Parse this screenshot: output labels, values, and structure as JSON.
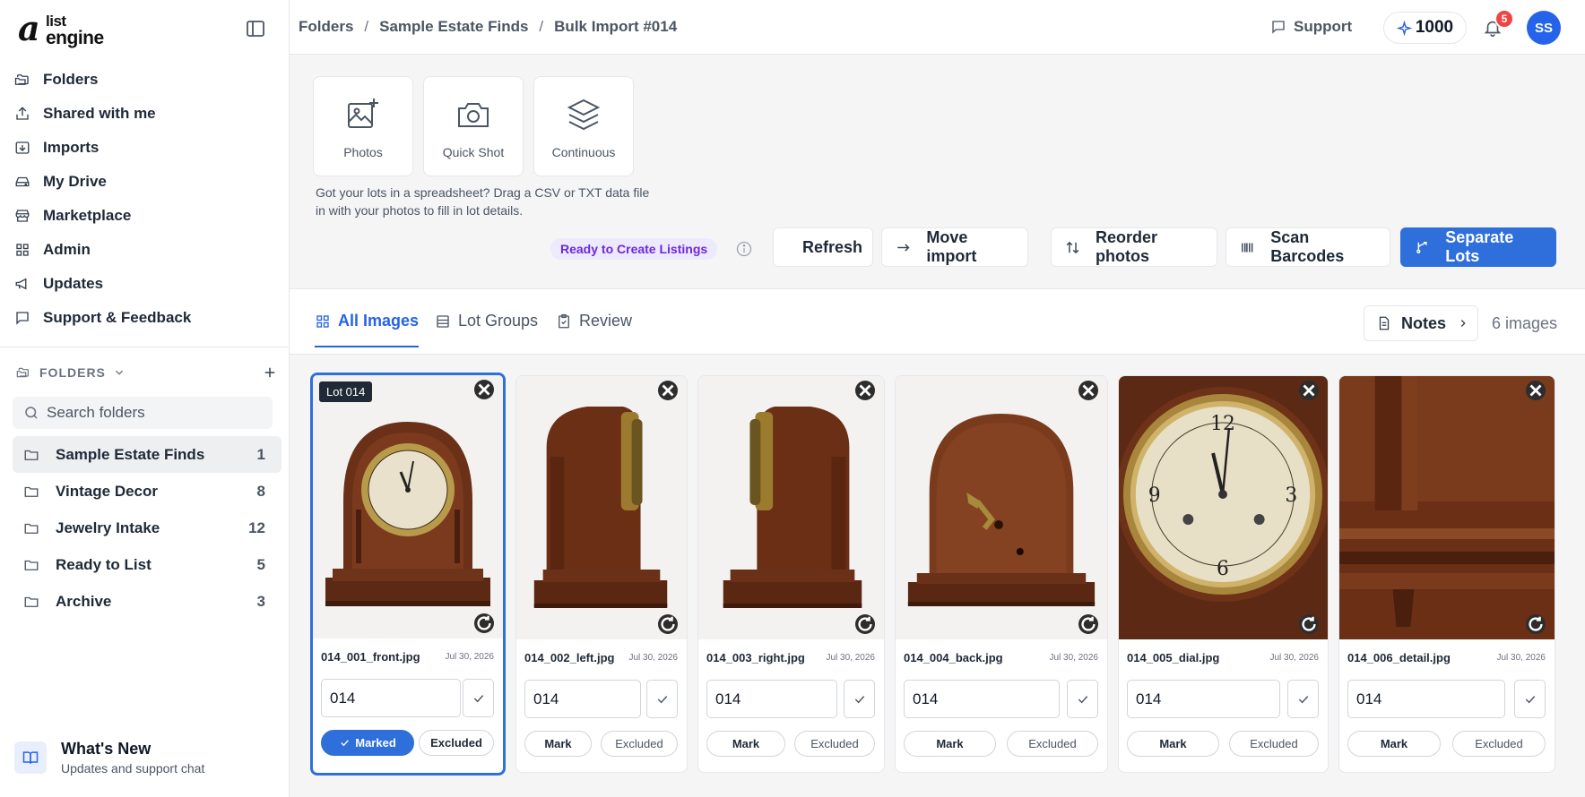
{
  "logo": {
    "a": "a",
    "list": "list",
    "engine": "engine"
  },
  "nav": [
    {
      "label": "Folders",
      "icon": "folders-icon"
    },
    {
      "label": "Shared with me",
      "icon": "share-icon"
    },
    {
      "label": "Imports",
      "icon": "import-icon"
    },
    {
      "label": "My Drive",
      "icon": "drive-icon"
    },
    {
      "label": "Marketplace",
      "icon": "store-icon"
    },
    {
      "label": "Admin",
      "icon": "grid-icon"
    },
    {
      "label": "Updates",
      "icon": "megaphone-icon"
    },
    {
      "label": "Support & Feedback",
      "icon": "message-icon"
    }
  ],
  "folders_section": {
    "title": "FOLDERS",
    "search_placeholder": "Search folders",
    "items": [
      {
        "name": "Sample Estate Finds",
        "count": "1",
        "active": true
      },
      {
        "name": "Vintage Decor",
        "count": "8"
      },
      {
        "name": "Jewelry Intake",
        "count": "12"
      },
      {
        "name": "Ready to List",
        "count": "5"
      },
      {
        "name": "Archive",
        "count": "3"
      }
    ]
  },
  "whats_new": {
    "title": "What's New",
    "subtitle": "Updates and support chat"
  },
  "breadcrumb": [
    "Folders",
    "Sample Estate Finds",
    "Bulk Import #014"
  ],
  "header": {
    "support": "Support",
    "credits": "1000",
    "notifications": "5",
    "avatar": "SS"
  },
  "upload": {
    "tiles": [
      "Photos",
      "Quick Shot",
      "Continuous"
    ],
    "hint": "Got your lots in a spreadsheet? Drag a CSV or TXT data file in with your photos to fill in lot details.",
    "status": "Ready to Create Listings",
    "buttons": [
      "Refresh",
      "Move import",
      "Reorder photos",
      "Scan Barcodes",
      "Separate Lots"
    ]
  },
  "tabs": [
    "All Images",
    "Lot Groups",
    "Review"
  ],
  "notes_label": "Notes",
  "image_count": "6 images",
  "colors": {
    "accent": "#2f6fdc",
    "badge": "#ef4444",
    "status_bg": "#ede9fe",
    "status_fg": "#6d28d9"
  },
  "images": [
    {
      "lot_label": "Lot 014",
      "filename": "014_001_front.jpg",
      "date": "Jul 30, 2026",
      "lot": "014",
      "mark": "Marked",
      "excluded": "Excluded",
      "marked": true,
      "view": "front"
    },
    {
      "filename": "014_002_left.jpg",
      "date": "Jul 30, 2026",
      "lot": "014",
      "mark": "Mark",
      "excluded": "Excluded",
      "view": "left"
    },
    {
      "filename": "014_003_right.jpg",
      "date": "Jul 30, 2026",
      "lot": "014",
      "mark": "Mark",
      "excluded": "Excluded",
      "view": "right"
    },
    {
      "filename": "014_004_back.jpg",
      "date": "Jul 30, 2026",
      "lot": "014",
      "mark": "Mark",
      "excluded": "Excluded",
      "view": "back"
    },
    {
      "filename": "014_005_dial.jpg",
      "date": "Jul 30, 2026",
      "lot": "014",
      "mark": "Mark",
      "excluded": "Excluded",
      "view": "dial"
    },
    {
      "filename": "014_006_detail.jpg",
      "date": "Jul 30, 2026",
      "lot": "014",
      "mark": "Mark",
      "excluded": "Excluded",
      "view": "detail"
    }
  ]
}
